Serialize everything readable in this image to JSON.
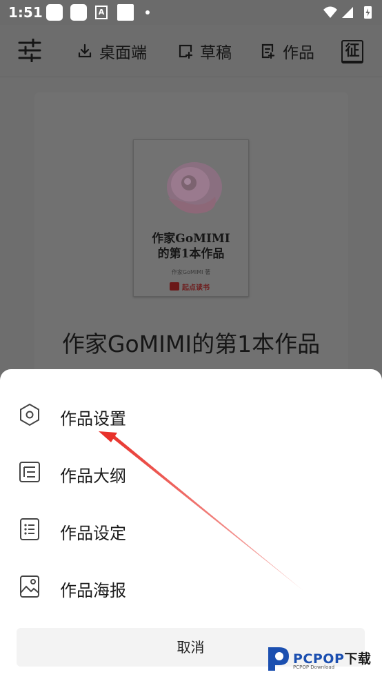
{
  "status_bar": {
    "time": "1:51",
    "a_icon_letter": "A"
  },
  "toolbar": {
    "items": [
      {
        "label": "桌面端",
        "icon": "download-icon"
      },
      {
        "label": "草稿",
        "icon": "add-draft-icon"
      },
      {
        "label": "作品",
        "icon": "works-icon"
      }
    ],
    "zheng_label": "征"
  },
  "card": {
    "cover_title_line1": "作家GoMIMI",
    "cover_title_line2": "的第1本作品",
    "cover_author": "作家GoMIMI 著",
    "cover_brand": "起点读书",
    "work_title": "作家GoMIMI的第1本作品"
  },
  "sheet": {
    "menu": [
      {
        "label": "作品设置",
        "icon": "hexagon-settings-icon"
      },
      {
        "label": "作品大纲",
        "icon": "outline-icon"
      },
      {
        "label": "作品设定",
        "icon": "list-icon"
      },
      {
        "label": "作品海报",
        "icon": "image-icon"
      }
    ],
    "cancel_label": "取消"
  },
  "watermark": {
    "text": "PCPOP",
    "text_dl": "下载",
    "sub": "PCPOP Download"
  },
  "colors": {
    "overlay": "#6e6e6e",
    "sheet": "#ffffff",
    "arrow": "#e8312a",
    "brand_blue": "#1b4fb0"
  }
}
